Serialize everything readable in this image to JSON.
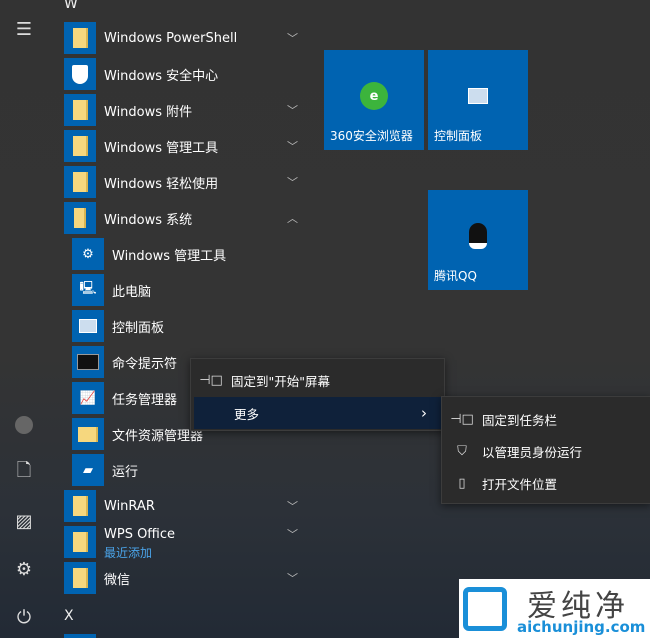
{
  "rail": {
    "icons": [
      "hamburger-menu-icon",
      "user-icon",
      "document-icon",
      "pictures-icon",
      "settings-icon",
      "power-icon"
    ]
  },
  "list": {
    "letter_w": "W",
    "letter_x": "X",
    "items": [
      {
        "label": "Windows PowerShell",
        "icon": "folder-icon",
        "expand": "down"
      },
      {
        "label": "Windows 安全中心",
        "icon": "shield-icon"
      },
      {
        "label": "Windows 附件",
        "icon": "folder-icon",
        "expand": "down"
      },
      {
        "label": "Windows 管理工具",
        "icon": "folder-icon",
        "expand": "down"
      },
      {
        "label": "Windows 轻松使用",
        "icon": "folder-icon",
        "expand": "down"
      },
      {
        "label": "Windows 系统",
        "icon": "folder-open-icon",
        "expand": "up"
      }
    ],
    "sub": [
      {
        "label": "Windows 管理工具",
        "icon": "admin-tools-icon"
      },
      {
        "label": "此电脑",
        "icon": "computer-icon"
      },
      {
        "label": "控制面板",
        "icon": "control-panel-icon"
      },
      {
        "label": "命令提示符",
        "icon": "command-prompt-icon"
      },
      {
        "label": "任务管理器",
        "icon": "task-manager-icon"
      },
      {
        "label": "文件资源管理器",
        "icon": "file-explorer-icon"
      },
      {
        "label": "运行",
        "icon": "run-icon"
      }
    ],
    "after": [
      {
        "label": "WinRAR",
        "expand": "down"
      },
      {
        "label": "WPS Office",
        "expand": "down",
        "badge": "最近添加"
      },
      {
        "label": "微信",
        "expand": "down"
      }
    ]
  },
  "tiles": [
    {
      "label": "360安全浏览器"
    },
    {
      "label": "控制面板"
    },
    {
      "label": "腾讯QQ"
    }
  ],
  "context_menu": {
    "items": [
      {
        "label": "固定到\"开始\"屏幕",
        "icon": "pin-icon"
      },
      {
        "label": "更多",
        "icon": "chevron-right-icon"
      }
    ]
  },
  "submenu": {
    "items": [
      {
        "label": "固定到任务栏",
        "icon": "pin-icon"
      },
      {
        "label": "以管理员身份运行",
        "icon": "admin-shield-icon"
      },
      {
        "label": "打开文件位置",
        "icon": "folder-location-icon"
      }
    ]
  },
  "watermark": {
    "brand": "爱纯净",
    "url": "aichunjing.com"
  }
}
